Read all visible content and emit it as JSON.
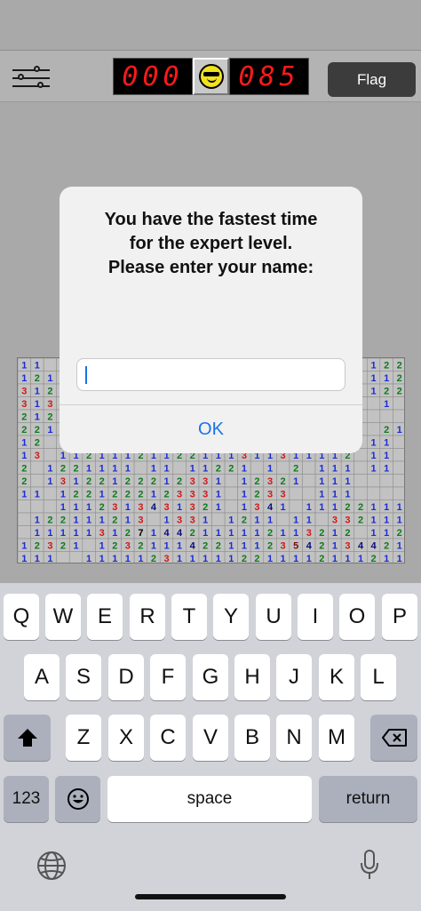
{
  "toolbar": {
    "settings_icon": "sliders-icon",
    "mine_counter": "000",
    "timer": "085",
    "face_icon": "sunglasses-smiley-icon",
    "flag_label": "Flag"
  },
  "board": {
    "rows": [
      "11                         122",
      "121                        112",
      "312                        122",
      "313                         1 ",
      "212                           ",
      "221                         21",
      "12                         11 ",
      "13 11211121122111311311112 11 ",
      "2 1221111 11 11221 1 2 111 11 ",
      "2 13122122212331 12321 111    ",
      "11 1221222123331 1233  111    ",
      "   1112313431321 1341 11122111",
      " 122111213 1331 1211 11 332111",
      " 1111131271442111112113212 112",
      "12321 1232111422111235421344211",
      "111  1111123111112211112111211"
    ]
  },
  "alert": {
    "message_lines": [
      "You have the fastest time",
      "for the expert level.",
      "Please enter your name:"
    ],
    "input_value": "",
    "ok_label": "OK"
  },
  "keyboard": {
    "row1": [
      "Q",
      "W",
      "E",
      "R",
      "T",
      "Y",
      "U",
      "I",
      "O",
      "P"
    ],
    "row2": [
      "A",
      "S",
      "D",
      "F",
      "G",
      "H",
      "J",
      "K",
      "L"
    ],
    "row3": [
      "Z",
      "X",
      "C",
      "V",
      "B",
      "N",
      "M"
    ],
    "shift_icon": "shift-arrow-icon",
    "delete_icon": "backspace-icon",
    "numbers_label": "123",
    "emoji_icon": "emoji-icon",
    "space_label": "space",
    "return_label": "return",
    "globe_icon": "globe-icon",
    "mic_icon": "microphone-icon"
  }
}
